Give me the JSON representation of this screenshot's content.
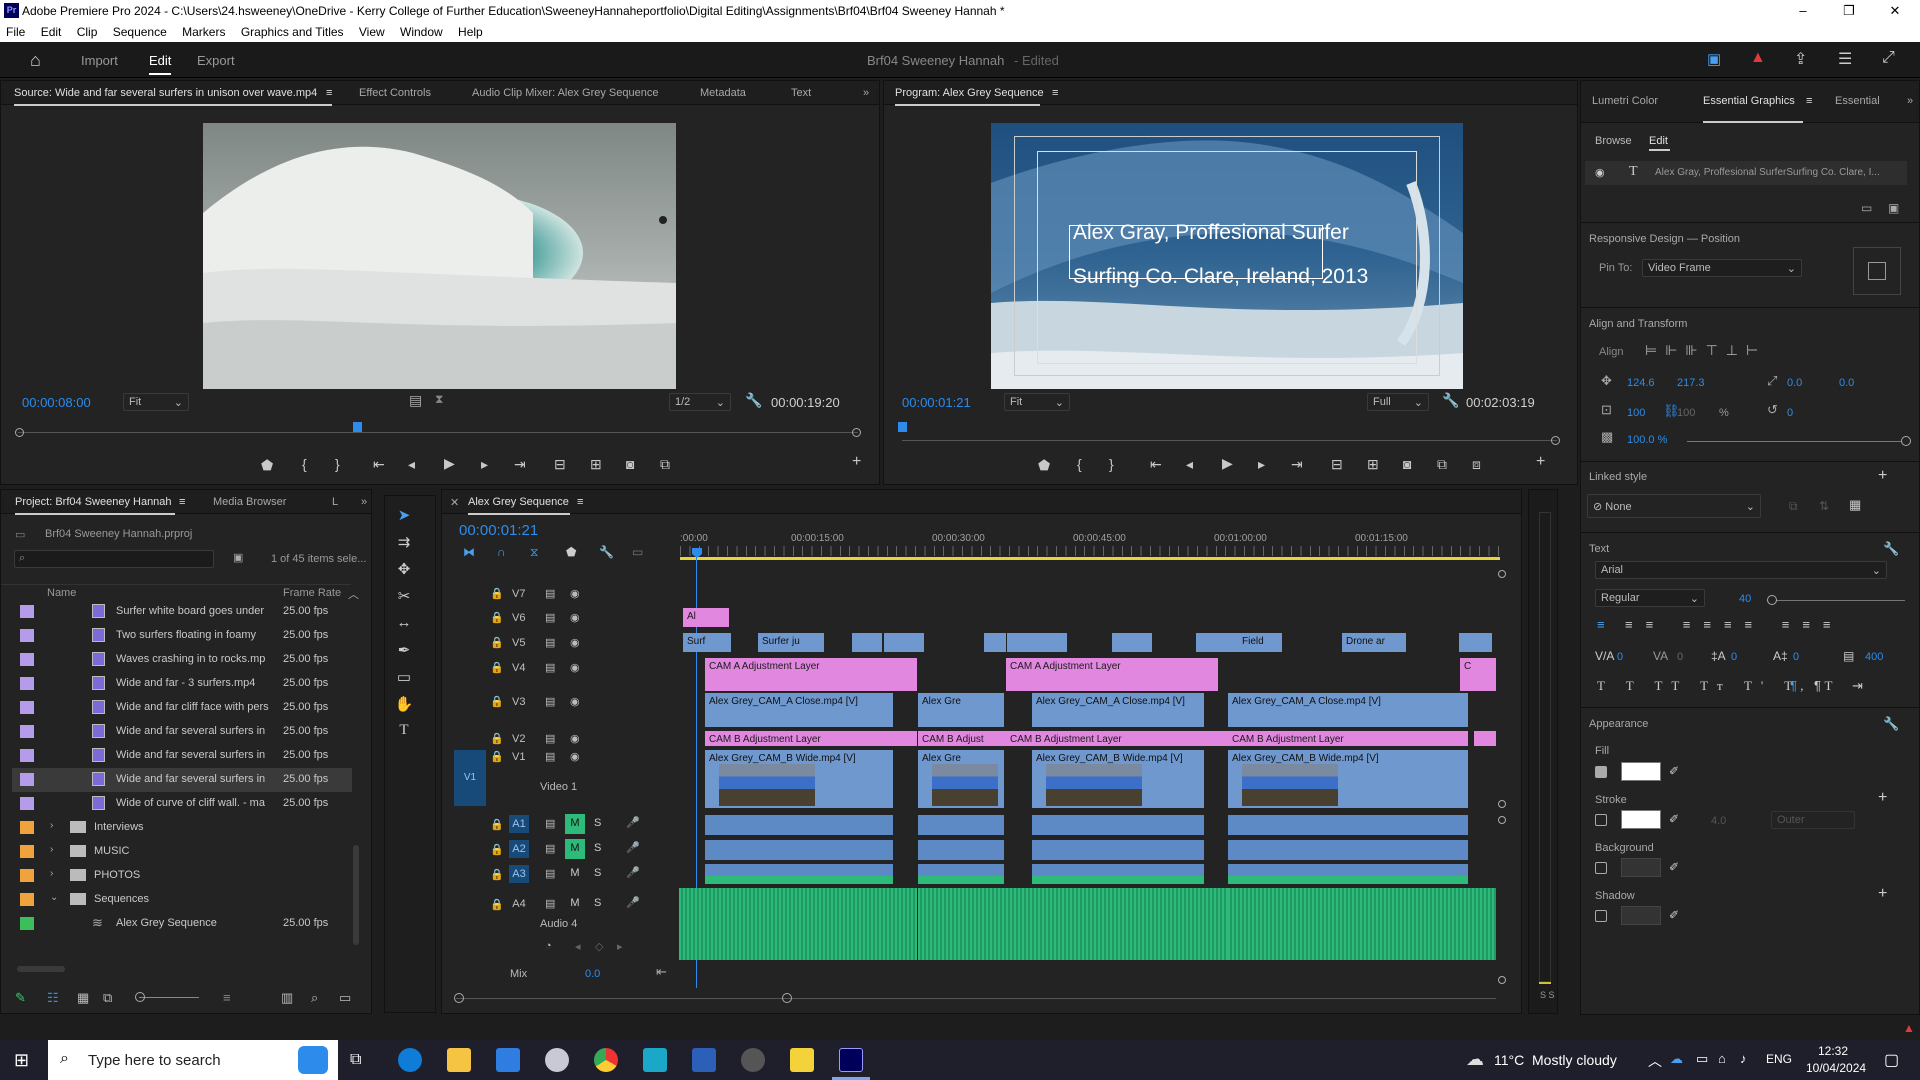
{
  "window": {
    "title": "Adobe Premiere Pro 2024 - C:\\Users\\24.hsweeney\\OneDrive - Kerry College of Further Education\\SweeneyHannaheportfolio\\Digital Editing\\Assignments\\Brf04\\Brf04 Sweeney Hannah *",
    "app_badge": "Pr"
  },
  "menu": [
    "File",
    "Edit",
    "Clip",
    "Sequence",
    "Markers",
    "Graphics and Titles",
    "View",
    "Window",
    "Help"
  ],
  "workspace": {
    "tabs": [
      "Import",
      "Edit",
      "Export"
    ],
    "active": "Edit",
    "project_title": "Brf04 Sweeney Hannah",
    "status": "- Edited"
  },
  "source": {
    "tabs": [
      "Source: Wide and far several surfers in unison over wave.mp4",
      "Effect Controls",
      "Audio Clip Mixer: Alex Grey Sequence",
      "Metadata",
      "Text"
    ],
    "timecode": "00:00:08:00",
    "fit": "Fit",
    "resolution": "1/2",
    "duration": "00:00:19:20"
  },
  "program": {
    "tab": "Program: Alex Grey Sequence",
    "timecode": "00:00:01:21",
    "fit": "Fit",
    "resolution": "Full",
    "duration": "00:02:03:19",
    "overlay_line1": "Alex Gray, Proffesional Surfer",
    "overlay_line2": "Surfing Co. Clare, Ireland, 2013"
  },
  "project": {
    "tabs": [
      "Project: Brf04 Sweeney Hannah",
      "Media Browser",
      "L"
    ],
    "file": "Brf04 Sweeney Hannah.prproj",
    "count": "1 of 45 items sele...",
    "col_name": "Name",
    "col_rate": "Frame Rate",
    "items": [
      {
        "name": "Surfer white board goes under",
        "rate": "25.00 fps",
        "color": "#b59ce8"
      },
      {
        "name": "Two surfers floating in foamy",
        "rate": "25.00 fps",
        "color": "#b59ce8"
      },
      {
        "name": "Waves crashing in to rocks.mp",
        "rate": "25.00 fps",
        "color": "#b59ce8"
      },
      {
        "name": "Wide and far - 3 surfers.mp4",
        "rate": "25.00 fps",
        "color": "#b59ce8"
      },
      {
        "name": "Wide and far cliff face with pers",
        "rate": "25.00 fps",
        "color": "#b59ce8"
      },
      {
        "name": "Wide and far several surfers in",
        "rate": "25.00 fps",
        "color": "#b59ce8"
      },
      {
        "name": "Wide and far several surfers in",
        "rate": "25.00 fps",
        "color": "#b59ce8"
      },
      {
        "name": "Wide and far several surfers in",
        "rate": "25.00 fps",
        "color": "#b59ce8"
      },
      {
        "name": "Wide of curve of cliff wall. - ma",
        "rate": "25.00 fps",
        "color": "#b59ce8"
      }
    ],
    "bins": [
      {
        "name": "Interviews",
        "color": "#f0a23c"
      },
      {
        "name": "MUSIC",
        "color": "#f0a23c"
      },
      {
        "name": "PHOTOS",
        "color": "#f0a23c"
      },
      {
        "name": "Sequences",
        "color": "#f0a23c"
      }
    ],
    "sequence_item": {
      "name": "Alex Grey Sequence",
      "rate": "25.00 fps",
      "color": "#3bbf5b"
    }
  },
  "timeline": {
    "tab": "Alex Grey Sequence",
    "timecode": "00:00:01:21",
    "ruler": [
      ":00:00",
      "00:00:15:00",
      "00:00:30:00",
      "00:00:45:00",
      "00:01:00:00",
      "00:01:15:00"
    ],
    "tracks": {
      "video": [
        "V7",
        "V6",
        "V5",
        "V4",
        "V3",
        "V2",
        "V1"
      ],
      "v1_name": "Video 1",
      "source_patch": "V1",
      "audio": [
        "A1",
        "A2",
        "A3",
        "A4"
      ],
      "a4_name": "Audio 4",
      "mix_label": "Mix",
      "mix_value": "0.0"
    },
    "clips": {
      "v6": "Al",
      "v5": [
        "Surf",
        "Surfer ju",
        "Field",
        "Drone ar"
      ],
      "v4": [
        "CAM A Adjustment Layer",
        "CAM A Adjustment Layer",
        "C"
      ],
      "v3": [
        "Alex Grey_CAM_A Close.mp4 [V]",
        "Alex Gre",
        "Alex Grey_CAM_A Close.mp4 [V]",
        "Alex Grey_CAM_A Close.mp4 [V]"
      ],
      "v2": [
        "CAM B Adjustment Layer",
        "CAM B Adjust",
        "CAM B Adjustment Layer",
        "CAM B Adjustment Layer"
      ],
      "v1": [
        "Alex Grey_CAM_B Wide.mp4 [V]",
        "Alex Gre",
        "Alex Grey_CAM_B Wide.mp4 [V]",
        "Alex Grey_CAM_B Wide.mp4 [V]"
      ]
    }
  },
  "essential_graphics": {
    "tabs": [
      "Lumetri Color",
      "Essential Graphics",
      "Essential"
    ],
    "subtabs": [
      "Browse",
      "Edit"
    ],
    "layer": "Alex Gray, Proffesional SurferSurfing Co. Clare, I...",
    "responsive": "Responsive Design — Position",
    "pin_to_label": "Pin To:",
    "pin_to": "Video Frame",
    "align_title": "Align and Transform",
    "align_label": "Align",
    "pos_x": "124.6",
    "pos_y": "217.3",
    "anchor_x": "0.0",
    "anchor_y": "0.0",
    "scale": "100",
    "scale2": "100",
    "scale_unit": "%",
    "rotation": "0",
    "opacity": "100.0 %",
    "linked_title": "Linked style",
    "linked": "None",
    "text_title": "Text",
    "font": "Arial",
    "style": "Regular",
    "size": "40",
    "kern": "0",
    "track": "0",
    "lead": "0",
    "baseline": "0",
    "tsume": "400",
    "appearance": "Appearance",
    "fill": "Fill",
    "stroke": "Stroke",
    "stroke_width": "4.0",
    "stroke_pos": "Outer",
    "background": "Background",
    "shadow": "Shadow"
  },
  "taskbar": {
    "search": "Type here to search",
    "weather": "11°C  Mostly cloudy",
    "lang": "ENG",
    "time": "12:32",
    "date": "10/04/2024"
  },
  "colors": {
    "accent": "#2d8ceb",
    "adjustment": "#e287e0",
    "video_clip": "#6f98cf",
    "audio_clip": "#2dba7b"
  }
}
